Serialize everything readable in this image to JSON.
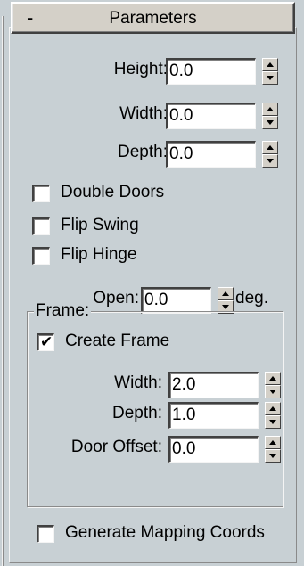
{
  "rollout": {
    "collapse_sign": "-",
    "title": "Parameters"
  },
  "parameters": {
    "height": {
      "label": "Height:",
      "value": "0.0"
    },
    "width": {
      "label": "Width:",
      "value": "0.0"
    },
    "depth": {
      "label": "Depth:",
      "value": "0.0"
    }
  },
  "options": {
    "double_doors": {
      "label": "Double Doors",
      "checked": false
    },
    "flip_swing": {
      "label": "Flip Swing",
      "checked": false
    },
    "flip_hinge": {
      "label": "Flip Hinge",
      "checked": false
    }
  },
  "open": {
    "label": "Open:",
    "value": "0.0",
    "unit": "deg."
  },
  "frame": {
    "group_title": "Frame:",
    "create_frame": {
      "label": "Create Frame",
      "checked": true,
      "mark": "✔"
    },
    "width": {
      "label": "Width:",
      "value": "2.0"
    },
    "depth": {
      "label": "Depth:",
      "value": "1.0"
    },
    "door_offset": {
      "label": "Door Offset:",
      "value": "0.0"
    }
  },
  "mapping": {
    "generate_mapping_coords": {
      "label": "Generate Mapping Coords",
      "checked": false
    }
  },
  "icons": {
    "spinner": "spinner-arrows-icon",
    "checkmark": "checkmark-icon"
  }
}
